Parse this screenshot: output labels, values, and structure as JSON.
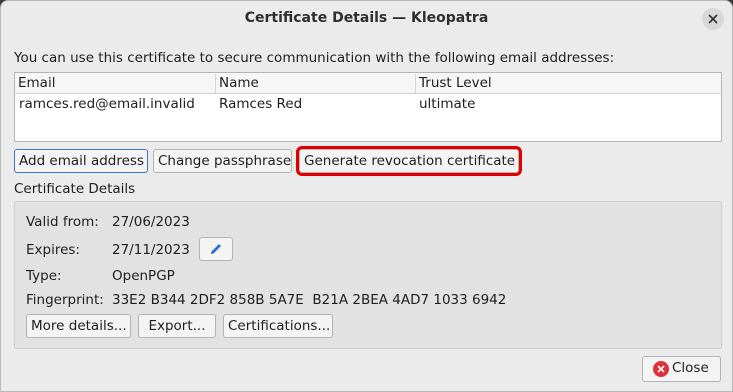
{
  "window": {
    "title": "Certificate Details — Kleopatra"
  },
  "intro_text": "You can use this certificate to secure communication with the following email addresses:",
  "email_table": {
    "columns": [
      "Email",
      "Name",
      "Trust Level"
    ],
    "rows": [
      [
        "ramces.red@email.invalid",
        "Ramces Red",
        "ultimate"
      ]
    ]
  },
  "buttons": {
    "add_email": "Add email address",
    "change_passphrase": "Change passphrase",
    "generate_revocation": "Generate revocation certificate"
  },
  "details": {
    "section_label": "Certificate Details",
    "valid_from_label": "Valid from:",
    "valid_from": "27/06/2023",
    "expires_label": "Expires:",
    "expires": "27/11/2023",
    "type_label": "Type:",
    "type": "OpenPGP",
    "fingerprint_label": "Fingerprint:",
    "fingerprint": "33E2 B344 2DF2 858B 5A7E  B21A 2BEA 4AD7 1033 6942",
    "more_details": "More details...",
    "export": "Export...",
    "certifications": "Certifications..."
  },
  "footer": {
    "close": "Close"
  },
  "icons": {
    "window_close": "close-icon",
    "edit_expiry": "pencil-icon",
    "close_button": "close-circle-icon"
  },
  "colors": {
    "highlight": "#e00000",
    "focus": "#3d78c2",
    "close_icon": "#e0303a"
  }
}
